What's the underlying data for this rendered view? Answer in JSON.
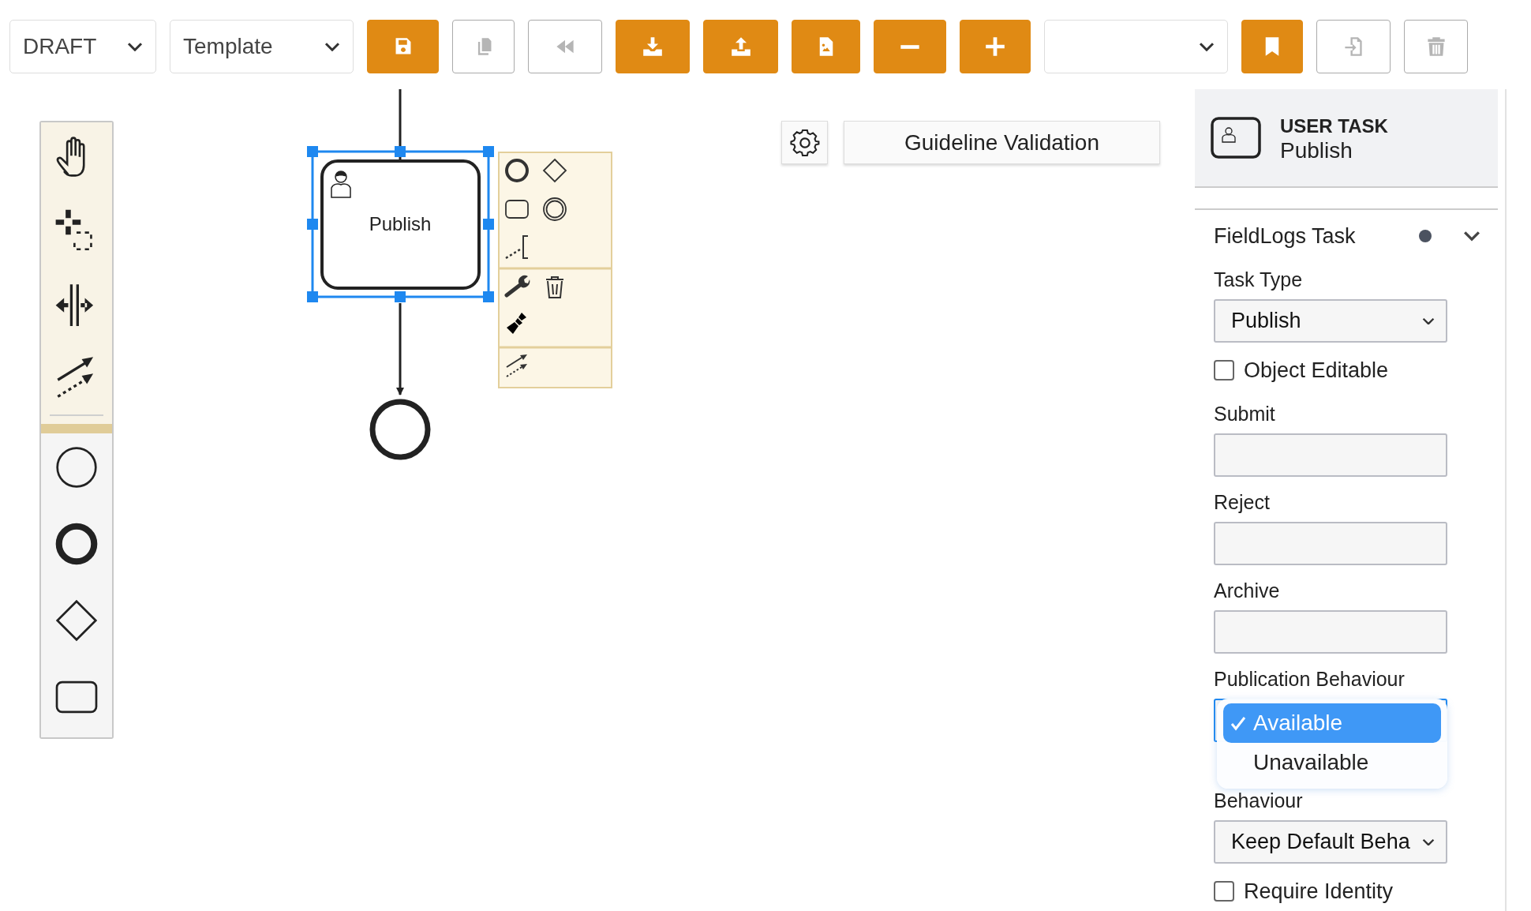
{
  "toolbar": {
    "items": [
      {
        "kind": "select",
        "value": "DRAFT"
      },
      {
        "kind": "select",
        "value": "Template"
      },
      {
        "kind": "save",
        "disabled": false
      },
      {
        "kind": "copy",
        "disabled": true
      },
      {
        "kind": "rewind",
        "disabled": true
      },
      {
        "kind": "download",
        "disabled": false
      },
      {
        "kind": "upload",
        "disabled": false
      },
      {
        "kind": "image-file",
        "disabled": false
      },
      {
        "kind": "zoom-out",
        "disabled": false
      },
      {
        "kind": "zoom-in",
        "disabled": false
      },
      {
        "kind": "select"
      },
      {
        "kind": "bookmark",
        "disabled": false
      },
      {
        "kind": "import",
        "disabled": true
      },
      {
        "kind": "delete",
        "disabled": true
      }
    ]
  },
  "palette": {
    "tools": [
      {
        "kind": "hand"
      },
      {
        "kind": "lasso"
      },
      {
        "kind": "space"
      },
      {
        "kind": "connect"
      }
    ],
    "shapes": [
      {
        "kind": "start-event"
      },
      {
        "kind": "end-event"
      },
      {
        "kind": "gateway"
      },
      {
        "kind": "task"
      }
    ]
  },
  "diagram": {
    "task": {
      "label": "Publish",
      "selected": true
    },
    "context_pad": [
      {
        "kind": "end-event"
      },
      {
        "kind": "gateway"
      },
      {
        "kind": "task"
      },
      {
        "kind": "intermediate-event"
      },
      {
        "kind": "annotation"
      },
      {
        "kind": "wrench"
      },
      {
        "kind": "delete"
      },
      {
        "kind": "color"
      },
      {
        "kind": "connect"
      }
    ]
  },
  "guideline": {
    "label": "Guideline Validation"
  },
  "properties": {
    "header": {
      "type_label": "USER TASK",
      "name": "Publish"
    },
    "group": {
      "title": "FieldLogs Task",
      "modified": true,
      "expanded": true
    },
    "fields": [
      {
        "kind": "select",
        "label": "Task Type",
        "value": "Publish"
      },
      {
        "kind": "checkbox",
        "label": "Object Editable",
        "checked": false
      },
      {
        "kind": "text",
        "label": "Submit"
      },
      {
        "kind": "text",
        "label": "Reject"
      },
      {
        "kind": "text",
        "label": "Archive"
      },
      {
        "kind": "select",
        "label": "Publication Behaviour",
        "expanded": true,
        "options": [
          {
            "label": "Available",
            "selected": true
          },
          {
            "label": "Unavailable",
            "selected": false
          }
        ]
      },
      {
        "kind": "select",
        "label": "Behaviour",
        "value": "Keep Default Beha"
      },
      {
        "kind": "checkbox",
        "label": "Require Identity",
        "checked": false
      }
    ]
  }
}
